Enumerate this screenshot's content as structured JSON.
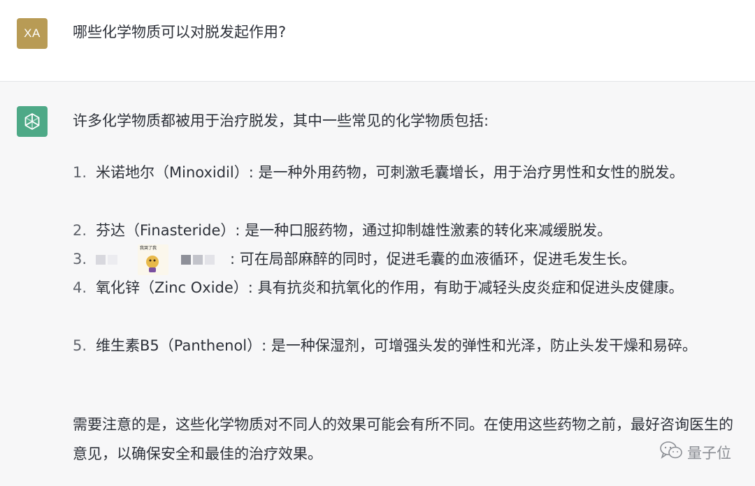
{
  "user": {
    "avatar_initials": "XA",
    "message": "哪些化学物质可以对脱发起作用?"
  },
  "assistant": {
    "avatar_icon": "openai-logo-icon",
    "intro": "许多化学物质都被用于治疗脱发，其中一些常见的化学物质包括:",
    "items": [
      {
        "number": "1.",
        "text": "米诺地尔（Minoxidil）: 是一种外用药物，可刺激毛囊增长，用于治疗男性和女性的脱发。"
      },
      {
        "number": "2.",
        "text": "芬达（Finasteride）: 是一种口服药物，通过抑制雄性激素的转化来减缓脱发。"
      },
      {
        "number": "3.",
        "text": ": 可在局部麻醉的同时，促进毛囊的血液循环，促进毛发生长。",
        "sticker_caption": "我哭了我"
      },
      {
        "number": "4.",
        "text": "氧化锌（Zinc Oxide）: 具有抗炎和抗氧化的作用，有助于减轻头皮炎症和促进头皮健康。"
      },
      {
        "number": "5.",
        "text": "维生素B5（Panthenol）: 是一种保湿剂，可增强头发的弹性和光泽，防止头发干燥和易碎。"
      }
    ],
    "outro": "需要注意的是，这些化学物质对不同人的效果可能会有所不同。在使用这些药物之前，最好咨询医生的意见，以确保安全和最佳的治疗效果。"
  },
  "watermark": {
    "text": "量子位",
    "icon": "wechat-icon"
  },
  "colors": {
    "user_avatar": "#b89b55",
    "assistant_avatar": "#4ea987",
    "assistant_bg": "#f7f7f8"
  }
}
